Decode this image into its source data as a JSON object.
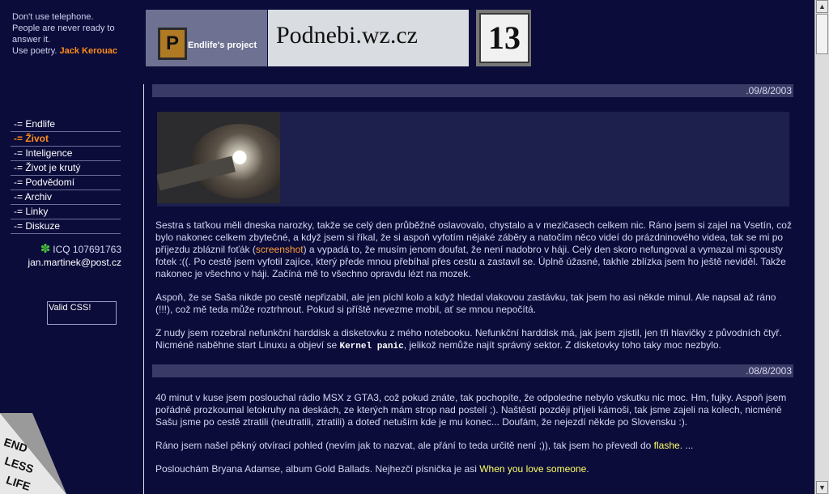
{
  "sidebar": {
    "quote_lines": [
      "Don't use telephone.",
      "People are never ready to",
      "answer it.",
      "Use poetry."
    ],
    "quote_author": "Jack Kerouac",
    "nav": [
      {
        "label": "-= Endlife",
        "active": false
      },
      {
        "label": "-= Život",
        "active": true
      },
      {
        "label": "-= Inteligence",
        "active": false
      },
      {
        "label": "-= Život je krutý",
        "active": false
      },
      {
        "label": "-= Podvědomí",
        "active": false
      },
      {
        "label": "-= Archiv",
        "active": false
      },
      {
        "label": "-= Linky",
        "active": false
      },
      {
        "label": "-= Diskuze",
        "active": false
      }
    ],
    "icq": "ICQ 107691763",
    "email": "jan.martinek@post.cz",
    "valid_css": "Valid CSS!",
    "corner_text": "END LESS LIFE"
  },
  "header": {
    "logo_letter": "P",
    "logo_sub": "Endlife's project",
    "site_name": "Podnebi.wz.cz",
    "number": "13"
  },
  "posts": [
    {
      "date": ".09/8/2003",
      "paragraphs": [
        {
          "before": " Sestra s taťkou měli dneska narozky, takže se celý den průběžně oslavovalo, chystalo a v mezičasech celkem nic. Ráno jsem si zajel na Vsetín, což bylo nakonec celkem zbytečné, a když jsem si říkal, že si aspoň vyfotím nějaké záběry a natočím něco videí do prázdninového videa, tak se mi po příjezdu zbláznil foťák (",
          "link": "screenshot",
          "after": ") a vypadá to, že musím jenom doufat, že není nadobro v háji. Celý den skoro nefungoval a vymazal mi spousty fotek :((. Po cestě jsem vyfotil zajíce, který přede mnou přebíhal přes cestu a zastavil se. Úplně úžasné, takhle zblízka jsem ho ještě neviděl. Takže nakonec je všechno v háji. Začíná mě to všechno opravdu lézt na mozek."
        },
        {
          "before": " Aspoň, že se Saša nikde po cestě nepřizabil, ale jen píchl kolo a když hledal vlakovou zastávku, tak jsem ho asi někde minul. Ale napsal až ráno (!!!), což mě teda může roztrhnout. Pokud si příště nevezme mobil, ať se mnou nepočítá.",
          "link": "",
          "after": ""
        },
        {
          "before": " Z nudy jsem rozebral nefunkční harddisk a disketovku z mého notebooku. Nefunkční harddisk má, jak jsem zjistil, jen tři hlavičky z původních čtyř. Nicméně naběhne start Linuxu a objeví se ",
          "code": "Kernel panic",
          "after": ", jelikož nemůže najít správný sektor. Z disketovky toho taky moc nezbylo."
        }
      ]
    },
    {
      "date": ".08/8/2003",
      "paragraphs": [
        {
          "before": " 40 minut v kuse jsem poslouchal rádio MSX z GTA3, což pokud znáte, tak pochopíte, že odpoledne nebylo vskutku nic moc. Hm, fujky. Aspoň jsem pořádně prozkoumal letokruhy na deskách, ze kterých mám strop nad postelí ;). Naštěstí později přijeli kámoši, tak jsme zajeli na kolech, nicméně Sašu jsme po cestě ztratili (neutratili, ztratili) a doteď netuším kde je mu konec... Doufám, že nejezdí někde po Slovensku :).",
          "link": "",
          "after": ""
        },
        {
          "before": " Ráno jsem našel pěkný otvírací pohled (nevím jak to nazvat, ale přání to teda určitě není ;)), tak jsem ho převedl do ",
          "link": "flashe",
          "after": ". ..."
        },
        {
          "before": " Poslouchám Bryana Adamse, album Gold Ballads. Nejhezčí písnička je asi ",
          "link": "When you love someone",
          "after": "."
        }
      ]
    }
  ]
}
